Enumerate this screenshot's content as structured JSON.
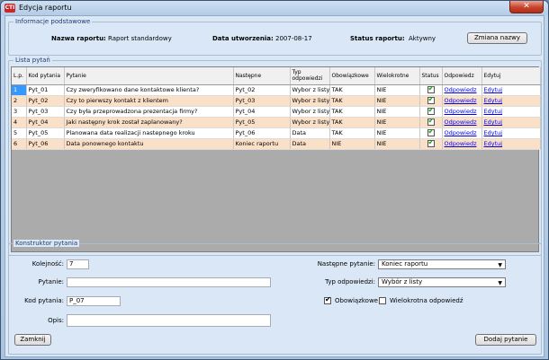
{
  "window": {
    "title": "Edycja raportu",
    "app_icon_text": "CTI",
    "close_glyph": "✕"
  },
  "info": {
    "legend": "Informacje podstawowe",
    "name_label": "Nazwa raportu:",
    "name_value": "Raport standardowy",
    "date_label": "Data utworzenia:",
    "date_value": "2007-08-17",
    "status_label": "Status raportu:",
    "status_value": "Aktywny",
    "rename_button": "Zmiana nazwy"
  },
  "list": {
    "legend": "Lista pytań",
    "columns": [
      "L.p.",
      "Kod pytania",
      "Pytanie",
      "Następne",
      "Typ odpowiedzi",
      "Obowiązkowe",
      "Wielokrotne",
      "Status",
      "Odpowiedz",
      "Edytuj"
    ],
    "rows": [
      {
        "lp": "1",
        "kod": "Pyt_01",
        "pytanie": "Czy zweryfikowano dane kontaktowe klienta?",
        "nastepne": "Pyt_02",
        "typ": "Wybor z listy",
        "obow": "TAK",
        "wielo": "NIE",
        "status": true,
        "odp": "Odpowiedz",
        "edytuj": "Edytuj"
      },
      {
        "lp": "2",
        "kod": "Pyt_02",
        "pytanie": "Czy to pierwszy kontakt z klientem",
        "nastepne": "Pyt_03",
        "typ": "Wybor z listy",
        "obow": "TAK",
        "wielo": "NIE",
        "status": true,
        "odp": "Odpowiedz",
        "edytuj": "Edytuj"
      },
      {
        "lp": "3",
        "kod": "Pyt_03",
        "pytanie": "Czy była przeprowadzona prezentacja firmy?",
        "nastepne": "Pyt_04",
        "typ": "Wybor z listy",
        "obow": "TAK",
        "wielo": "NIE",
        "status": true,
        "odp": "Odpowiedz",
        "edytuj": "Edytuj"
      },
      {
        "lp": "4",
        "kod": "Pyt_04",
        "pytanie": "Jaki następny krok został zaplanowany?",
        "nastepne": "Pyt_05",
        "typ": "Wybor z listy",
        "obow": "TAK",
        "wielo": "NIE",
        "status": true,
        "odp": "Odpowiedz",
        "edytuj": "Edytuj"
      },
      {
        "lp": "5",
        "kod": "Pyt_05",
        "pytanie": "Planowana data realizacji nastepnego kroku",
        "nastepne": "Pyt_06",
        "typ": "Data",
        "obow": "TAK",
        "wielo": "NIE",
        "status": true,
        "odp": "Odpowiedz",
        "edytuj": "Edytuj"
      },
      {
        "lp": "6",
        "kod": "Pyt_06",
        "pytanie": "Data ponownego kontaktu",
        "nastepne": "Koniec raportu",
        "typ": "Data",
        "obow": "NIE",
        "wielo": "NIE",
        "status": true,
        "odp": "Odpowiedz",
        "edytuj": "Edytuj"
      }
    ]
  },
  "builder": {
    "legend": "Konstruktor pytania",
    "order_label": "Kolejność:",
    "order_value": "7",
    "question_label": "Pytanie:",
    "question_value": "",
    "code_label": "Kod pytania:",
    "code_value": "P_07",
    "desc_label": "Opis:",
    "desc_value": "",
    "next_label": "Następne pytanie:",
    "next_value": "Koniec raportu",
    "type_label": "Typ odpowiedzi:",
    "type_value": "Wybór z listy",
    "mandatory_label": "Obowiązkowe",
    "mandatory_checked": true,
    "multi_label": "Wielokrotna odpowiedź",
    "multi_checked": false,
    "close_button": "Zamknij",
    "add_button": "Dodaj pytanie"
  }
}
